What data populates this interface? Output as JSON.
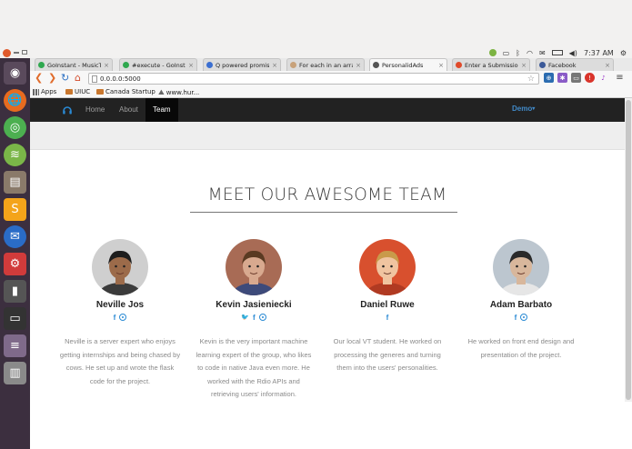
{
  "os": {
    "clock": "7:37 AM"
  },
  "browser": {
    "tabs": [
      {
        "title": "GoInstant - MusicTrack",
        "fav_color": "#2fa84f"
      },
      {
        "title": "#execute - GoInstant",
        "fav_color": "#2fa84f"
      },
      {
        "title": "Q powered promis - Go",
        "fav_color": "#3b6fd1"
      },
      {
        "title": "For each in an array. Ho",
        "fav_color": "#c8a27a"
      },
      {
        "title": "PersonalidAds",
        "fav_color": "#555555"
      },
      {
        "title": "Enter a Submission | VT",
        "fav_color": "#e04a2a"
      },
      {
        "title": "Facebook",
        "fav_color": "#3b5998"
      }
    ],
    "url": "0.0.0.0:5000",
    "bookmarks": [
      "Apps",
      "UIUC",
      "Canada Startup",
      "www.hur..."
    ]
  },
  "site": {
    "nav": {
      "home": "Home",
      "about": "About",
      "team": "Team",
      "demo": "Demo"
    },
    "heading": "MEET OUR AWESOME TEAM",
    "members": [
      {
        "name": "Neville Jos",
        "socials": [
          "facebook-icon",
          "rdio-icon"
        ],
        "bio": "Neville is a server expert who enjoys getting internships and being chased by cows. He set up and wrote the flask code for the project."
      },
      {
        "name": "Kevin Jasieniecki",
        "socials": [
          "twitter-icon",
          "facebook-icon",
          "rdio-icon"
        ],
        "bio": "Kevin is the very important machine learning expert of the group, who likes to code in native Java even more. He worked with the Rdio APIs and retrieving users' information."
      },
      {
        "name": "Daniel Ruwe",
        "socials": [
          "facebook-icon"
        ],
        "bio": "Our local VT student. He worked on processing the generes and turning them into the users' personalities."
      },
      {
        "name": "Adam Barbato",
        "socials": [
          "facebook-icon",
          "rdio-icon"
        ],
        "bio": "He worked on front end design and presentation of the project."
      }
    ]
  },
  "colors": {
    "navbar": "#222222",
    "accent": "#2a8ad4",
    "launcher": "#3c2f3f"
  }
}
